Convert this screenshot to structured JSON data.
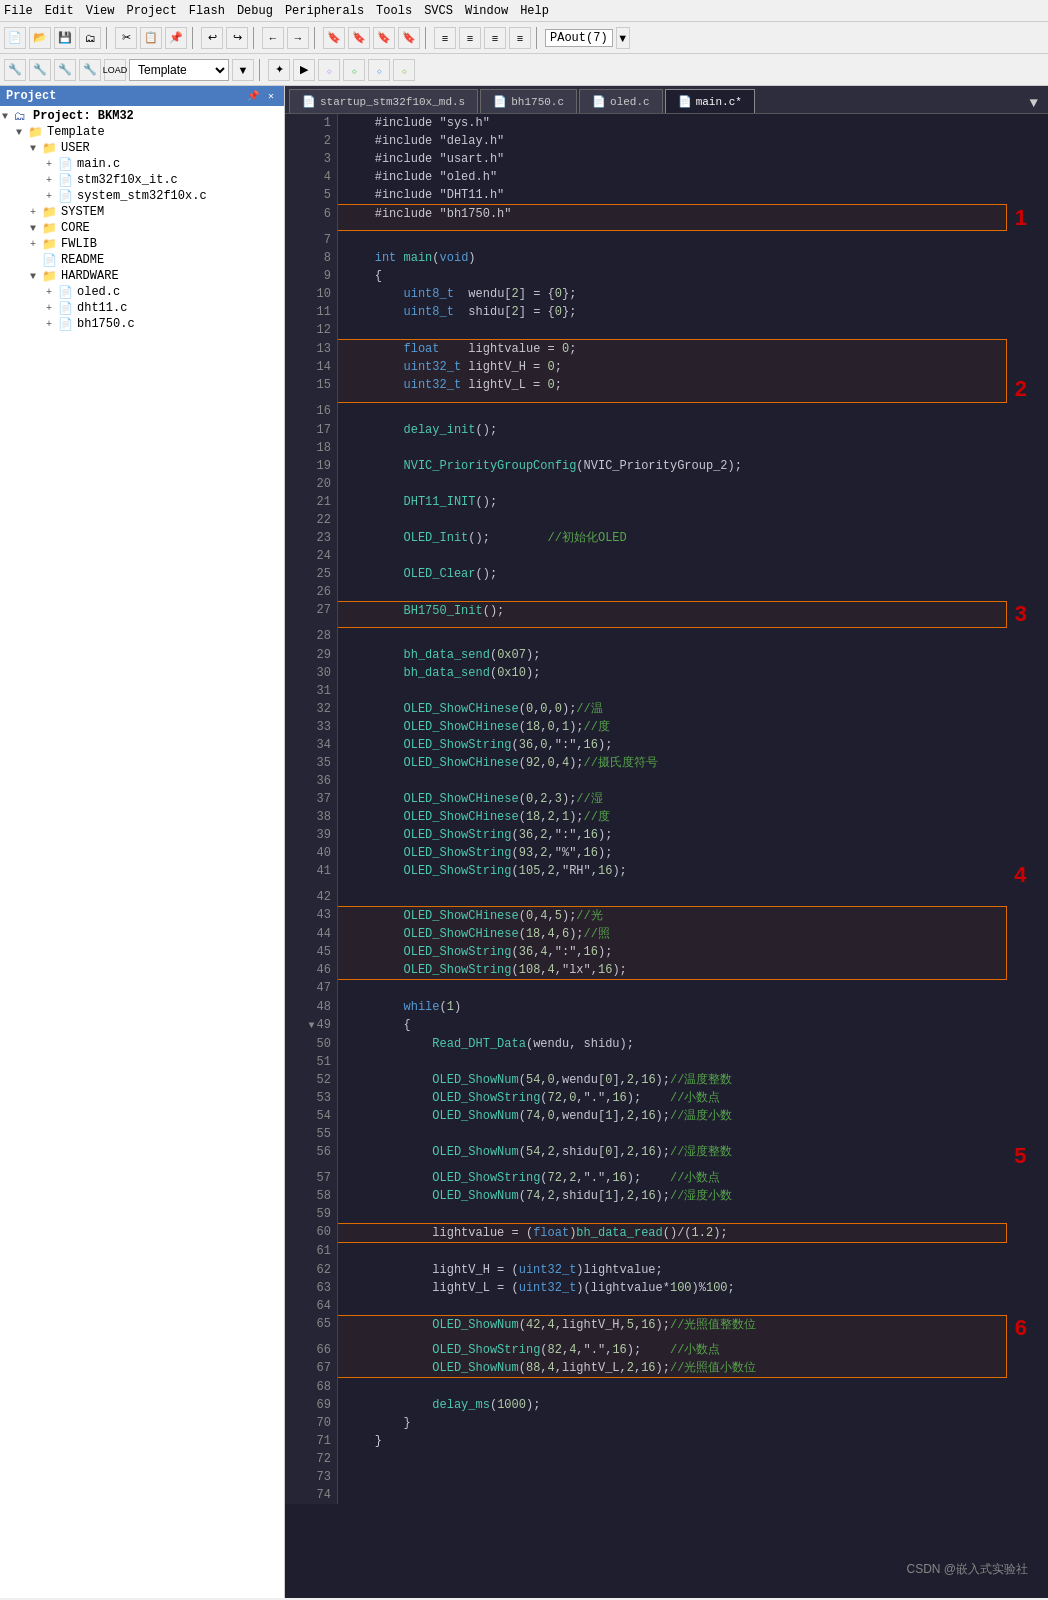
{
  "menubar": {
    "items": [
      "File",
      "Edit",
      "View",
      "Project",
      "Flash",
      "Debug",
      "Peripherals",
      "Tools",
      "SVCS",
      "Window",
      "Help"
    ]
  },
  "toolbar": {
    "combo_value": "Template",
    "paout": "PAout(7)"
  },
  "tabs": [
    {
      "label": "startup_stm32f10x_md.s",
      "active": false
    },
    {
      "label": "bh1750.c",
      "active": false
    },
    {
      "label": "oled.c",
      "active": false
    },
    {
      "label": "main.c*",
      "active": true
    }
  ],
  "sidebar": {
    "header": "Project",
    "tree": [
      {
        "indent": 0,
        "arrow": "▼",
        "icon": "📁",
        "label": "Project: BKM32"
      },
      {
        "indent": 1,
        "arrow": "▼",
        "icon": "📁",
        "label": "Template"
      },
      {
        "indent": 2,
        "arrow": "▼",
        "icon": "📁",
        "label": "USER"
      },
      {
        "indent": 3,
        "arrow": "+",
        "icon": "📄",
        "label": "main.c"
      },
      {
        "indent": 3,
        "arrow": "+",
        "icon": "📄",
        "label": "stm32f10x_it.c"
      },
      {
        "indent": 3,
        "arrow": "+",
        "icon": "📄",
        "label": "system_stm32f10x.c"
      },
      {
        "indent": 2,
        "arrow": "+",
        "icon": "📁",
        "label": "SYSTEM"
      },
      {
        "indent": 2,
        "arrow": "▼",
        "icon": "📁",
        "label": "CORE"
      },
      {
        "indent": 2,
        "arrow": "+",
        "icon": "📁",
        "label": "FWLIB"
      },
      {
        "indent": 2,
        "arrow": "",
        "icon": "📄",
        "label": "README"
      },
      {
        "indent": 2,
        "arrow": "▼",
        "icon": "📁",
        "label": "HARDWARE"
      },
      {
        "indent": 3,
        "arrow": "+",
        "icon": "📄",
        "label": "oled.c"
      },
      {
        "indent": 3,
        "arrow": "+",
        "icon": "📄",
        "label": "dht11.c"
      },
      {
        "indent": 3,
        "arrow": "+",
        "icon": "📄",
        "label": "bh1750.c"
      }
    ]
  },
  "code": {
    "lines": [
      {
        "n": 1,
        "text": "    #include \"sys.h\""
      },
      {
        "n": 2,
        "text": "    #include \"delay.h\""
      },
      {
        "n": 3,
        "text": "    #include \"usart.h\""
      },
      {
        "n": 4,
        "text": "    #include \"oled.h\""
      },
      {
        "n": 5,
        "text": "    #include \"DHT11.h\""
      },
      {
        "n": 6,
        "text": "    #include \"bh1750.h\"",
        "highlight": "box1"
      },
      {
        "n": 7,
        "text": ""
      },
      {
        "n": 8,
        "text": "    int main(void)"
      },
      {
        "n": 9,
        "text": "    {"
      },
      {
        "n": 10,
        "text": "        uint8_t  wendu[2] = {0};"
      },
      {
        "n": 11,
        "text": "        uint8_t  shidu[2] = {0};"
      },
      {
        "n": 12,
        "text": ""
      },
      {
        "n": 13,
        "text": "        float    lightvalue = 0;",
        "highlight": "box2_start"
      },
      {
        "n": 14,
        "text": "        uint32_t lightV_H = 0;"
      },
      {
        "n": 15,
        "text": "        uint32_t lightV_L = 0;",
        "highlight": "box2_end"
      },
      {
        "n": 16,
        "text": ""
      },
      {
        "n": 17,
        "text": "        delay_init();"
      },
      {
        "n": 18,
        "text": ""
      },
      {
        "n": 19,
        "text": "        NVIC_PriorityGroupConfig(NVIC_PriorityGroup_2);"
      },
      {
        "n": 20,
        "text": ""
      },
      {
        "n": 21,
        "text": "        DHT11_INIT();"
      },
      {
        "n": 22,
        "text": ""
      },
      {
        "n": 23,
        "text": "        OLED_Init();        //初始化OLED"
      },
      {
        "n": 24,
        "text": ""
      },
      {
        "n": 25,
        "text": "        OLED_Clear();"
      },
      {
        "n": 26,
        "text": ""
      },
      {
        "n": 27,
        "text": "        BH1750_Init();",
        "highlight": "box3"
      },
      {
        "n": 28,
        "text": ""
      },
      {
        "n": 29,
        "text": "        bh_data_send(0x07);"
      },
      {
        "n": 30,
        "text": "        bh_data_send(0x10);"
      },
      {
        "n": 31,
        "text": ""
      },
      {
        "n": 32,
        "text": "        OLED_ShowCHinese(0,0,0);//温"
      },
      {
        "n": 33,
        "text": "        OLED_ShowCHinese(18,0,1);//度"
      },
      {
        "n": 34,
        "text": "        OLED_ShowString(36,0,\":\",16);"
      },
      {
        "n": 35,
        "text": "        OLED_ShowCHinese(92,0,4);//摄氏度符号"
      },
      {
        "n": 36,
        "text": ""
      },
      {
        "n": 37,
        "text": "        OLED_ShowCHinese(0,2,3);//湿"
      },
      {
        "n": 38,
        "text": "        OLED_ShowCHinese(18,2,1);//度"
      },
      {
        "n": 39,
        "text": "        OLED_ShowString(36,2,\":\",16);"
      },
      {
        "n": 40,
        "text": "        OLED_ShowString(93,2,\"%\",16);"
      },
      {
        "n": 41,
        "text": "        OLED_ShowString(105,2,\"RH\",16);"
      },
      {
        "n": 42,
        "text": ""
      },
      {
        "n": 43,
        "text": "        OLED_ShowCHinese(0,4,5);//光",
        "highlight": "box4_start"
      },
      {
        "n": 44,
        "text": "        OLED_ShowCHinese(18,4,6);//照"
      },
      {
        "n": 45,
        "text": "        OLED_ShowString(36,4,\":\",16);"
      },
      {
        "n": 46,
        "text": "        OLED_ShowString(108,4,\"lx\",16);",
        "highlight": "box4_end"
      },
      {
        "n": 47,
        "text": ""
      },
      {
        "n": 48,
        "text": "        while(1)"
      },
      {
        "n": 49,
        "text": "        {",
        "collapse": true
      },
      {
        "n": 50,
        "text": "            Read_DHT_Data(wendu, shidu);"
      },
      {
        "n": 51,
        "text": ""
      },
      {
        "n": 52,
        "text": "            OLED_ShowNum(54,0,wendu[0],2,16);//温度整数"
      },
      {
        "n": 53,
        "text": "            OLED_ShowString(72,0,\".\",16);    //小数点"
      },
      {
        "n": 54,
        "text": "            OLED_ShowNum(74,0,wendu[1],2,16);//温度小数"
      },
      {
        "n": 55,
        "text": ""
      },
      {
        "n": 56,
        "text": "            OLED_ShowNum(54,2,shidu[0],2,16);//湿度整数"
      },
      {
        "n": 57,
        "text": "            OLED_ShowString(72,2,\".\",16);    //小数点"
      },
      {
        "n": 58,
        "text": "            OLED_ShowNum(74,2,shidu[1],2,16);//湿度小数"
      },
      {
        "n": 59,
        "text": ""
      },
      {
        "n": 60,
        "text": "            lightvalue = (float)bh_data_read()/(1.2);",
        "highlight": "box5"
      },
      {
        "n": 61,
        "text": ""
      },
      {
        "n": 62,
        "text": "            lightV_H = (uint32_t)lightvalue;"
      },
      {
        "n": 63,
        "text": "            lightV_L = (uint32_t)(lightvalue*100)%100;"
      },
      {
        "n": 64,
        "text": ""
      },
      {
        "n": 65,
        "text": "            OLED_ShowNum(42,4,lightV_H,5,16);//光照值整数位",
        "highlight": "box6_start"
      },
      {
        "n": 66,
        "text": "            OLED_ShowString(82,4,\".\",16);    //小数点"
      },
      {
        "n": 67,
        "text": "            OLED_ShowNum(88,4,lightV_L,2,16);//光照值小数位",
        "highlight": "box6_end"
      },
      {
        "n": 68,
        "text": ""
      },
      {
        "n": 69,
        "text": "            delay_ms(1000);"
      },
      {
        "n": 70,
        "text": "        }"
      },
      {
        "n": 71,
        "text": "    }"
      },
      {
        "n": 72,
        "text": ""
      },
      {
        "n": 73,
        "text": ""
      },
      {
        "n": 74,
        "text": ""
      }
    ]
  },
  "annotations": {
    "n1": "1",
    "n2": "2",
    "n3": "3",
    "n4": "4",
    "n5": "5",
    "n6": "6"
  },
  "watermark": "CSDN @嵌入式实验社"
}
